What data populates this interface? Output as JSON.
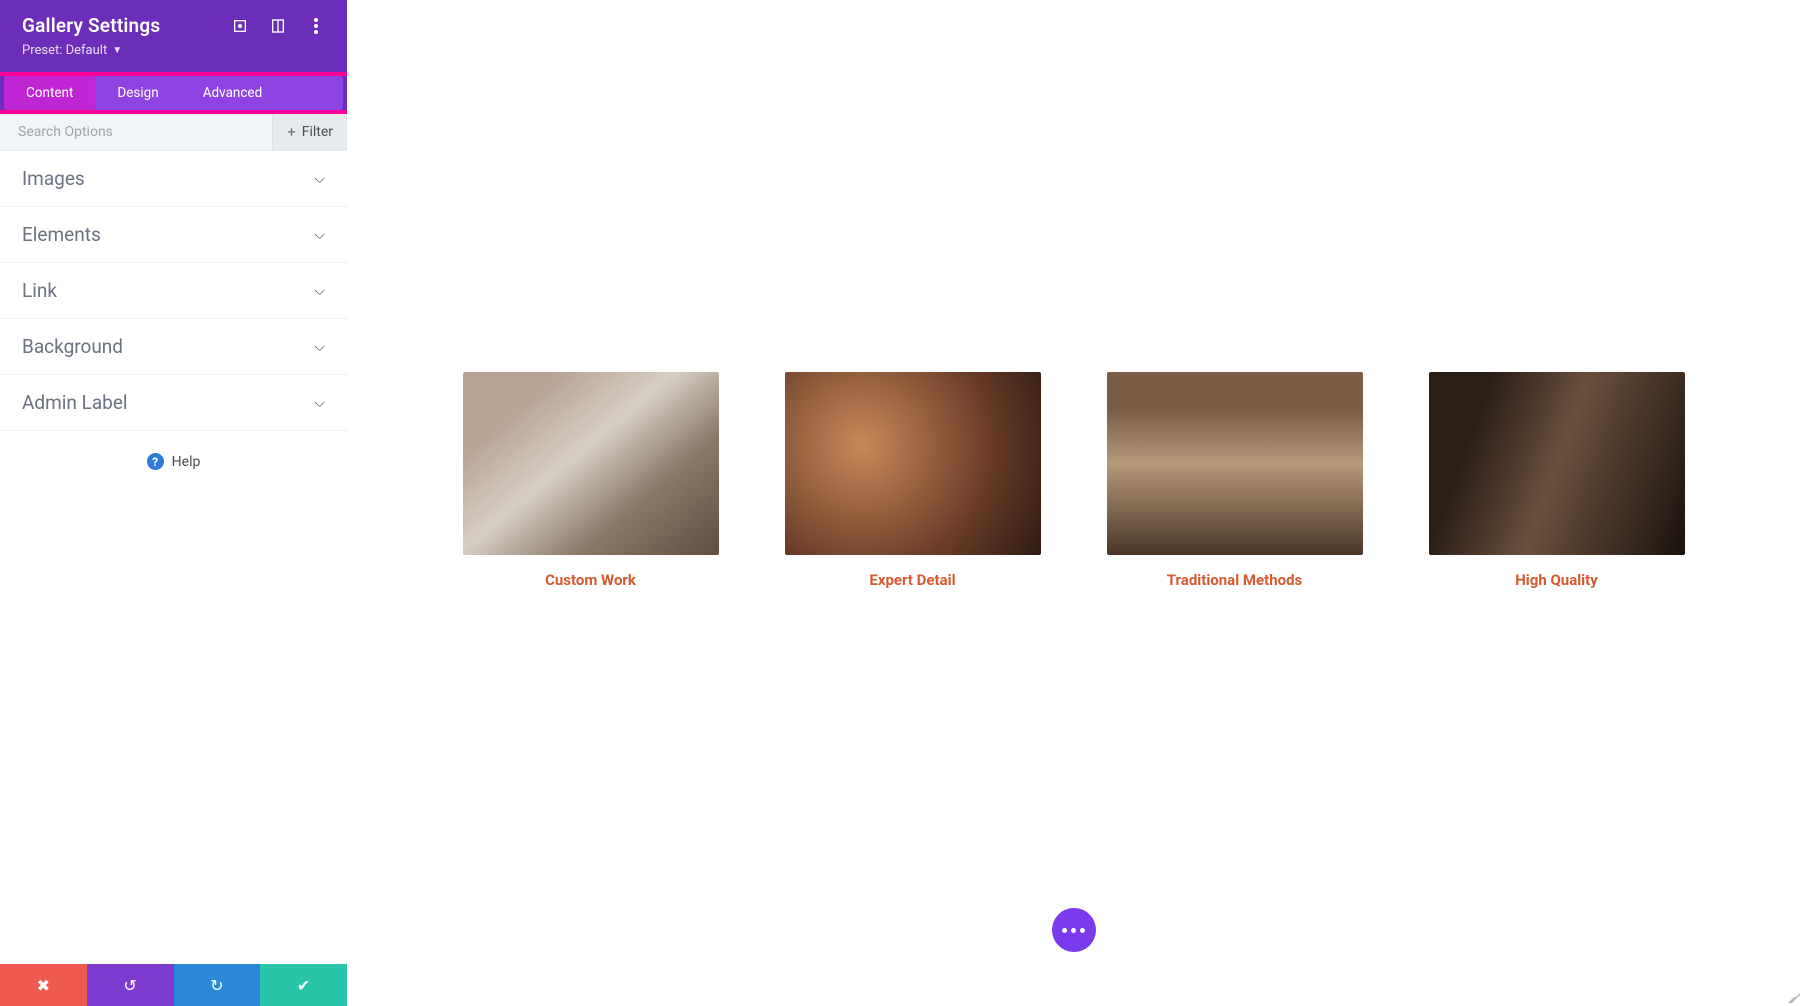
{
  "header": {
    "title": "Gallery Settings",
    "preset_label": "Preset: Default"
  },
  "tabs": [
    {
      "label": "Content",
      "active": true
    },
    {
      "label": "Design",
      "active": false
    },
    {
      "label": "Advanced",
      "active": false
    }
  ],
  "search": {
    "placeholder": "Search Options",
    "filter_label": "Filter"
  },
  "sections": [
    {
      "label": "Images"
    },
    {
      "label": "Elements"
    },
    {
      "label": "Link"
    },
    {
      "label": "Background"
    },
    {
      "label": "Admin Label"
    }
  ],
  "help_label": "Help",
  "gallery": [
    {
      "caption": "Custom Work"
    },
    {
      "caption": "Expert Detail"
    },
    {
      "caption": "Traditional Methods"
    },
    {
      "caption": "High Quality"
    }
  ],
  "colors": {
    "accent": "#6c2eb9",
    "tab_highlight_border": "#ff0099",
    "caption": "#d65a31"
  }
}
